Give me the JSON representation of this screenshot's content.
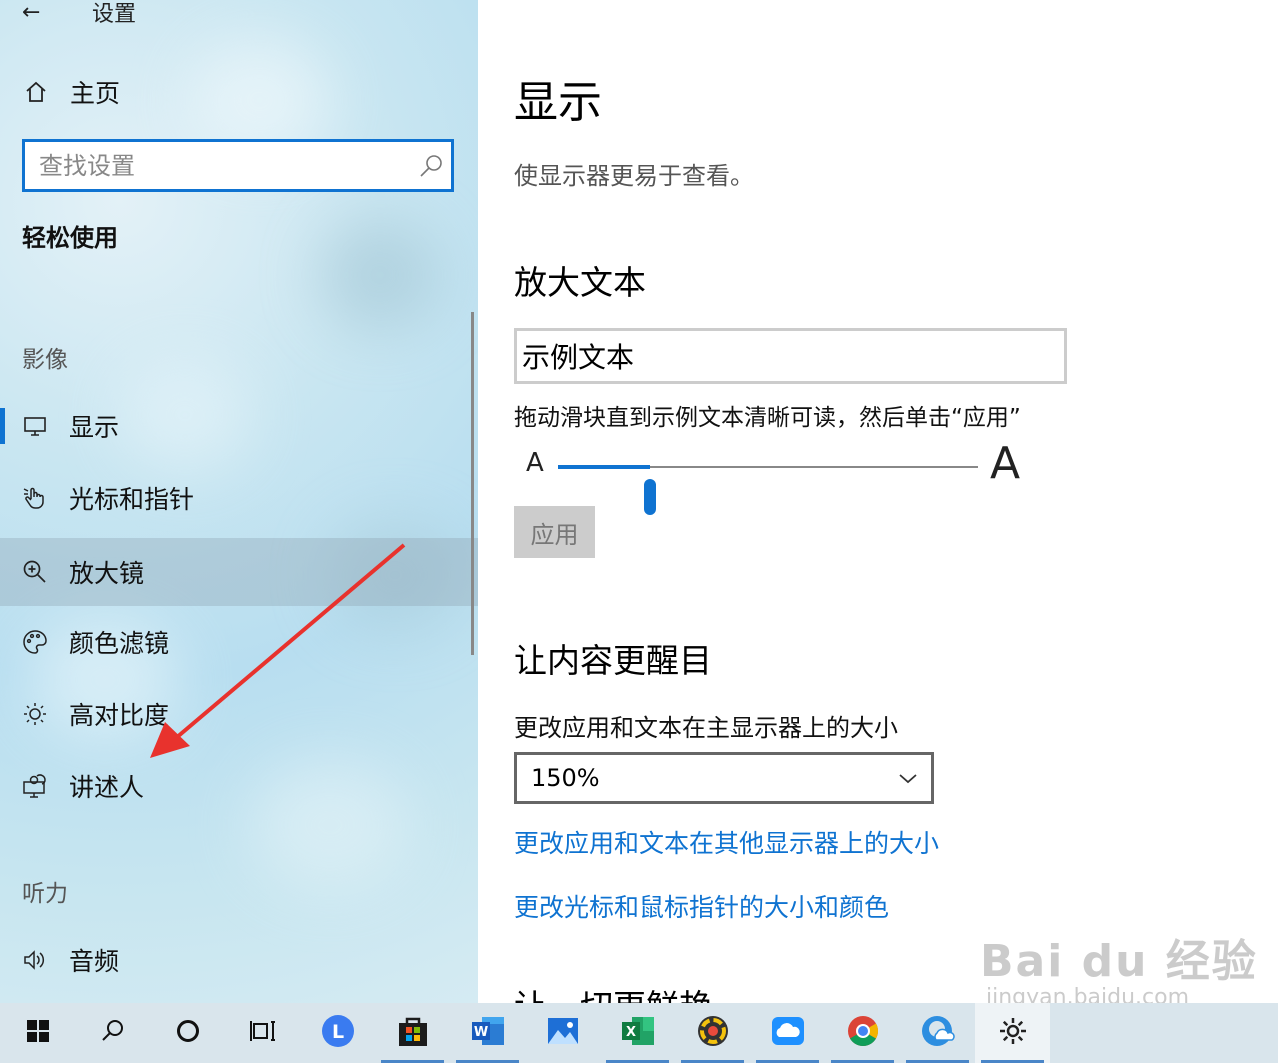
{
  "window": {
    "back_glyph": "←",
    "title": "设置"
  },
  "sidebar": {
    "home_label": "主页",
    "search_placeholder": "查找设置",
    "section_title": "轻松使用",
    "groups": {
      "vision": "影像",
      "hearing": "听力"
    },
    "items": [
      {
        "label": "显示",
        "icon": "monitor-icon",
        "selected": true
      },
      {
        "label": "光标和指针",
        "icon": "pointer-hand-icon"
      },
      {
        "label": "放大镜",
        "icon": "magnifier-icon",
        "hover": true
      },
      {
        "label": "颜色滤镜",
        "icon": "palette-icon"
      },
      {
        "label": "高对比度",
        "icon": "brightness-icon"
      },
      {
        "label": "讲述人",
        "icon": "narrator-icon"
      },
      {
        "label": "音频",
        "icon": "speaker-icon"
      }
    ]
  },
  "main": {
    "title": "显示",
    "subtitle": "使显示器更易于查看。",
    "enlarge_text": {
      "heading": "放大文本",
      "sample": "示例文本",
      "instruction": "拖动滑块直到示例文本清晰可读，然后单击“应用”",
      "small_a": "A",
      "large_a": "A",
      "slider_value_fraction": 0.22,
      "apply_label": "应用"
    },
    "bigger": {
      "heading": "让内容更醒目",
      "size_label": "更改应用和文本在主显示器上的大小",
      "size_value": "150%",
      "link1": "更改应用和文本在其他显示器上的大小",
      "link2": "更改光标和鼠标指针的大小和颜色"
    },
    "cut_heading": "让一切更鲜艳"
  },
  "watermark": {
    "line1": "Bai du 经验",
    "line2": "jingyan.baidu.com"
  },
  "taskbar": {
    "items": [
      "windows-start-icon",
      "search-icon",
      "cortana-icon",
      "task-view-icon",
      "lenovo-icon",
      "store-icon",
      "word-icon",
      "photos-icon",
      "excel-icon",
      "color-app-icon",
      "onedrive-icon",
      "chrome-icon",
      "edge-icon",
      "settings-icon"
    ]
  },
  "colors": {
    "accent": "#0f73d1",
    "annotation_arrow": "#e8322d"
  }
}
